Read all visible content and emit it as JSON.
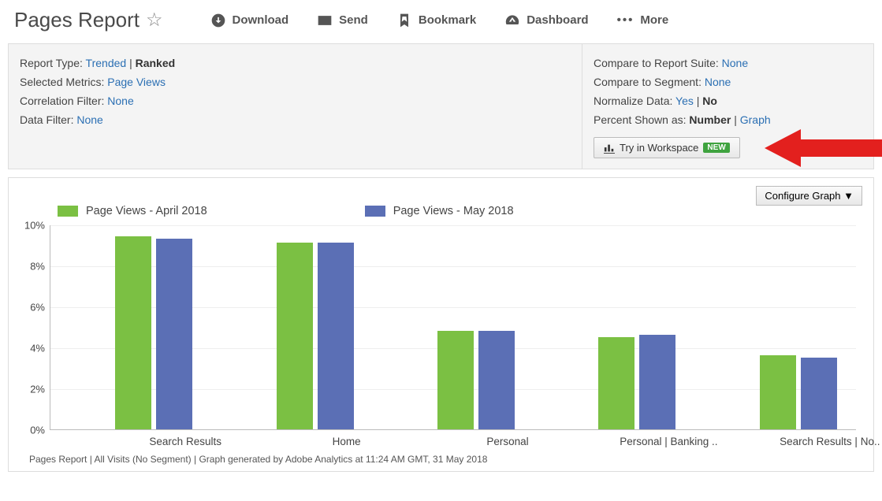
{
  "title": "Pages Report",
  "toolbar": {
    "download": "Download",
    "send": "Send",
    "bookmark": "Bookmark",
    "dashboard": "Dashboard",
    "more": "More"
  },
  "config_left": {
    "report_type_label": "Report Type:",
    "report_type_link": "Trended",
    "report_type_bold": "Ranked",
    "selected_metrics_label": "Selected Metrics:",
    "selected_metrics_link": "Page Views",
    "correlation_filter_label": "Correlation Filter:",
    "correlation_filter_link": "None",
    "data_filter_label": "Data Filter:",
    "data_filter_link": "None"
  },
  "config_right": {
    "compare_suite_label": "Compare to Report Suite:",
    "compare_suite_link": "None",
    "compare_segment_label": "Compare to Segment:",
    "compare_segment_link": "None",
    "normalize_label": "Normalize Data:",
    "normalize_link": "Yes",
    "normalize_bold": "No",
    "percent_label": "Percent Shown as:",
    "percent_bold": "Number",
    "percent_link": "Graph",
    "workspace_btn": "Try in Workspace",
    "workspace_badge": "NEW"
  },
  "chart_panel": {
    "configure_label": "Configure Graph  ▼",
    "legend_a": "Page Views - April 2018",
    "legend_b": "Page Views - May 2018",
    "y_ticks": [
      "0%",
      "2%",
      "4%",
      "6%",
      "8%",
      "10%"
    ],
    "footnote": "Pages Report | All Visits (No Segment) | Graph generated by Adobe Analytics at 11:24 AM GMT, 31 May 2018"
  },
  "chart_data": {
    "type": "bar",
    "categories": [
      "Search Results",
      "Home",
      "Personal",
      "Personal | Banking ..",
      "Search Results | No.."
    ],
    "series": [
      {
        "name": "Page Views - April 2018",
        "values": [
          9.4,
          9.1,
          4.8,
          4.5,
          3.6
        ]
      },
      {
        "name": "Page Views - May 2018",
        "values": [
          9.3,
          9.1,
          4.8,
          4.6,
          3.5
        ]
      }
    ],
    "ylabel": "",
    "xlabel": "",
    "ylim": [
      0,
      10
    ],
    "title": ""
  }
}
